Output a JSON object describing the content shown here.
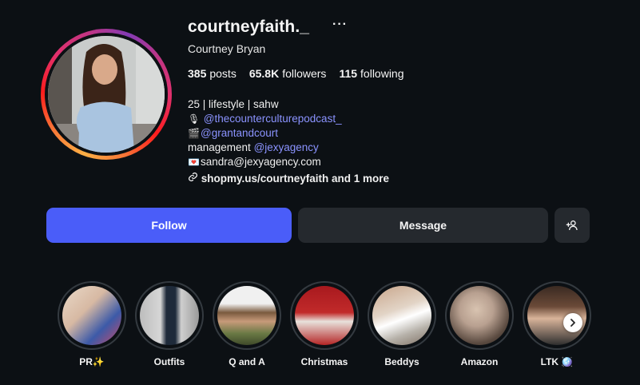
{
  "profile": {
    "username": "courtneyfaith._",
    "options_glyph": "···",
    "full_name": "Courtney Bryan"
  },
  "stats": {
    "posts_count": "385",
    "posts_label": "posts",
    "followers_count": "65.8K",
    "followers_label": "followers",
    "following_count": "115",
    "following_label": "following"
  },
  "bio": {
    "line1": "25 | lifestyle | sahw",
    "podcast_emoji": "🎙",
    "podcast_handle": "@thecounterculturepodcast_",
    "clapper_emoji": "🎬",
    "court_handle": "@grantandcourt",
    "management_prefix": "management ",
    "management_handle": "@jexyagency",
    "mail_emoji": "💌",
    "email": "sandra@jexyagency.com",
    "link_text": "shopmy.us/courtneyfaith and 1 more"
  },
  "actions": {
    "follow_label": "Follow",
    "message_label": "Message",
    "add_icon": "+👤"
  },
  "highlights": [
    {
      "label": "PR✨"
    },
    {
      "label": "Outfits"
    },
    {
      "label": "Q and A"
    },
    {
      "label": "Christmas"
    },
    {
      "label": "Beddys"
    },
    {
      "label": "Amazon"
    },
    {
      "label": "LTK 🪩"
    }
  ],
  "colors": {
    "background": "#0c1014",
    "follow_button": "#4a5df9",
    "secondary_button": "#25292e",
    "link": "#8b93ff"
  }
}
